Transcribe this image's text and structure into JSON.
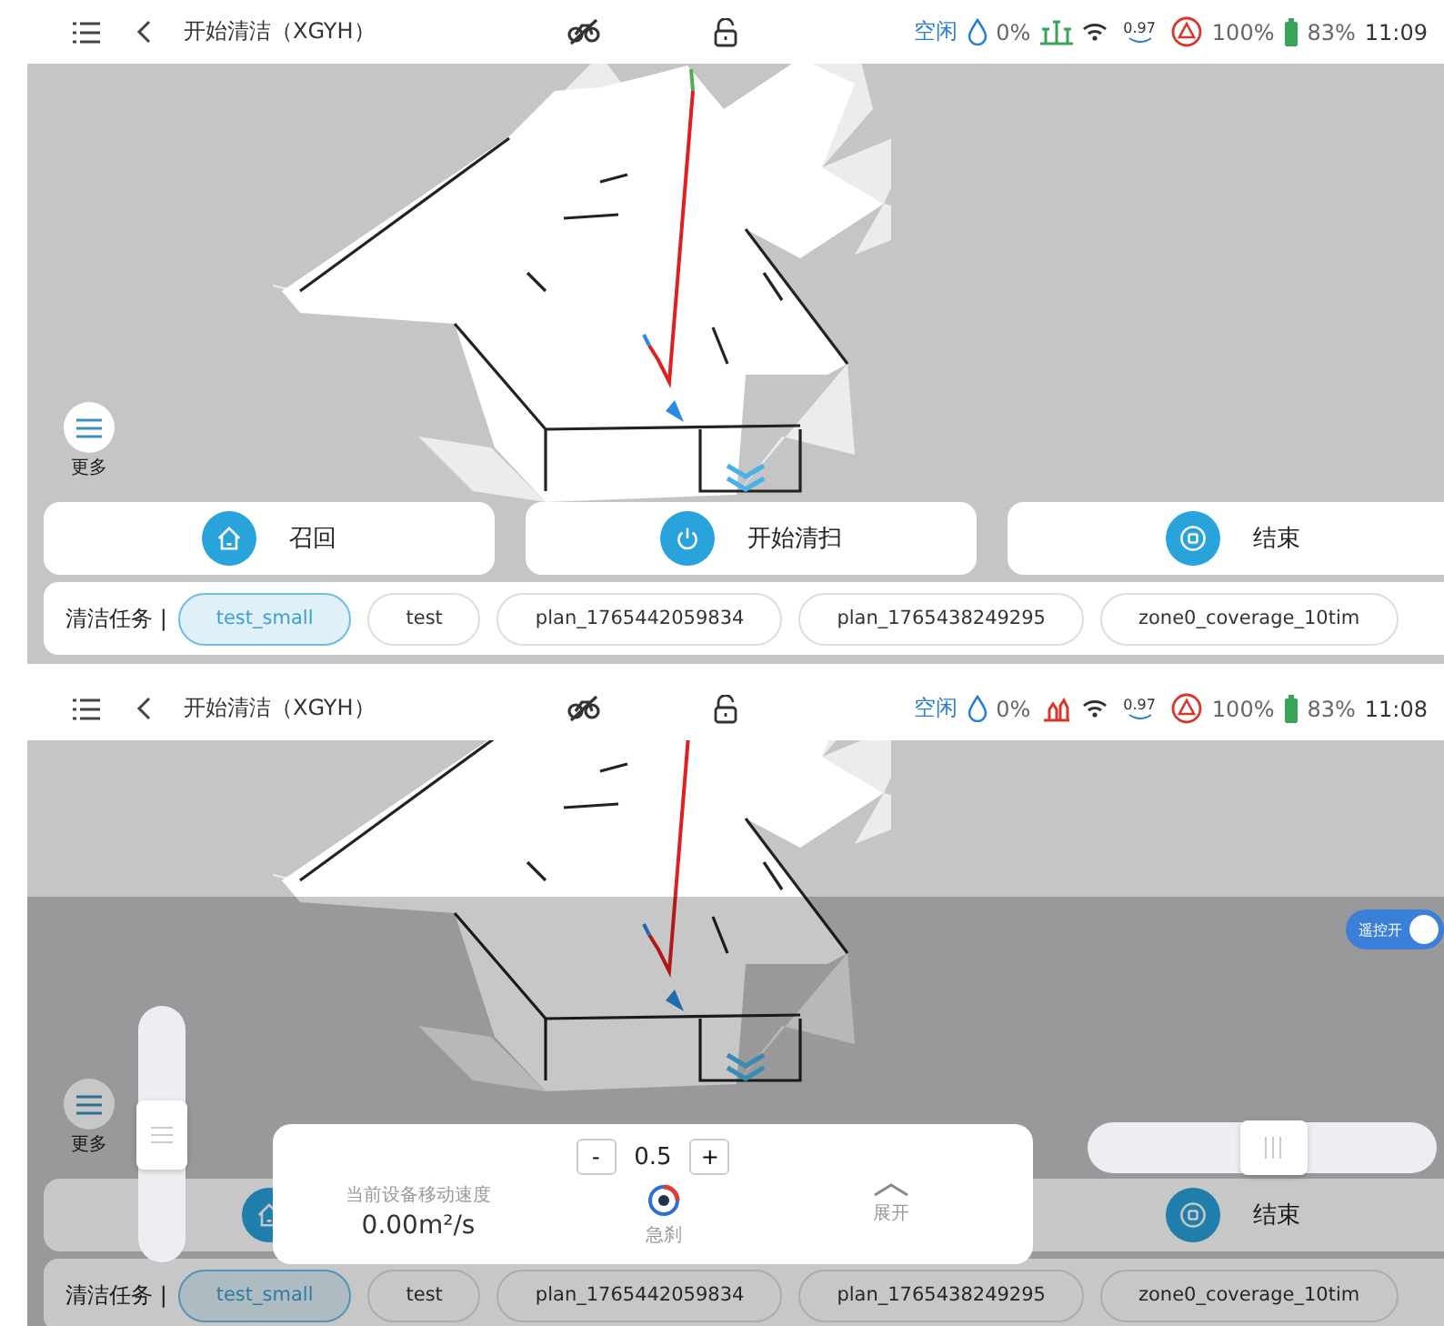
{
  "screens": [
    {
      "status_bar": {
        "title": "开始清洁（XGYH）",
        "state": "空闲",
        "water": "0%",
        "sensor_alert": false,
        "signal_value": "0.97",
        "charge": "100%",
        "battery": "83%",
        "time": "11:09"
      },
      "more_button": {
        "label": "更多"
      },
      "actions": [
        {
          "kind": "home",
          "label": "召回"
        },
        {
          "kind": "power",
          "label": "开始清扫"
        },
        {
          "kind": "stop",
          "label": "结束"
        }
      ],
      "tasks": {
        "label": "清洁任务 |",
        "items": [
          {
            "label": "test_small",
            "selected": true
          },
          {
            "label": "test",
            "selected": false
          },
          {
            "label": "plan_1765442059834",
            "selected": false
          },
          {
            "label": "plan_1765438249295",
            "selected": false
          },
          {
            "label": "zone0_coverage_10tim",
            "selected": false
          }
        ]
      }
    },
    {
      "status_bar": {
        "title": "开始清洁（XGYH）",
        "state": "空闲",
        "water": "0%",
        "sensor_alert": true,
        "signal_value": "0.97",
        "charge": "100%",
        "battery": "83%",
        "time": "11:08"
      },
      "more_button": {
        "label": "更多"
      },
      "actions": [
        {
          "kind": "home"
        },
        {
          "kind": "stop",
          "label": "结束"
        }
      ],
      "tasks": {
        "label": "清洁任务 |",
        "items": [
          {
            "label": "test_small",
            "selected": true
          },
          {
            "label": "test",
            "selected": false
          },
          {
            "label": "plan_1765442059834",
            "selected": false
          },
          {
            "label": "plan_1765438249295",
            "selected": false
          },
          {
            "label": "zone0_coverage_10tim",
            "selected": false
          }
        ]
      },
      "overlay": {
        "remote_toggle": {
          "label": "遥控开",
          "on": true
        },
        "vertical_slider": {
          "level": 0.5
        },
        "horizontal_slider": {
          "level": 0.54
        },
        "speed_panel": {
          "minus": "-",
          "step": "0.5",
          "plus": "+",
          "speed_label": "当前设备移动速度",
          "speed": "0.00m²/s",
          "brake": "急刹",
          "expand": "展开"
        }
      }
    }
  ]
}
